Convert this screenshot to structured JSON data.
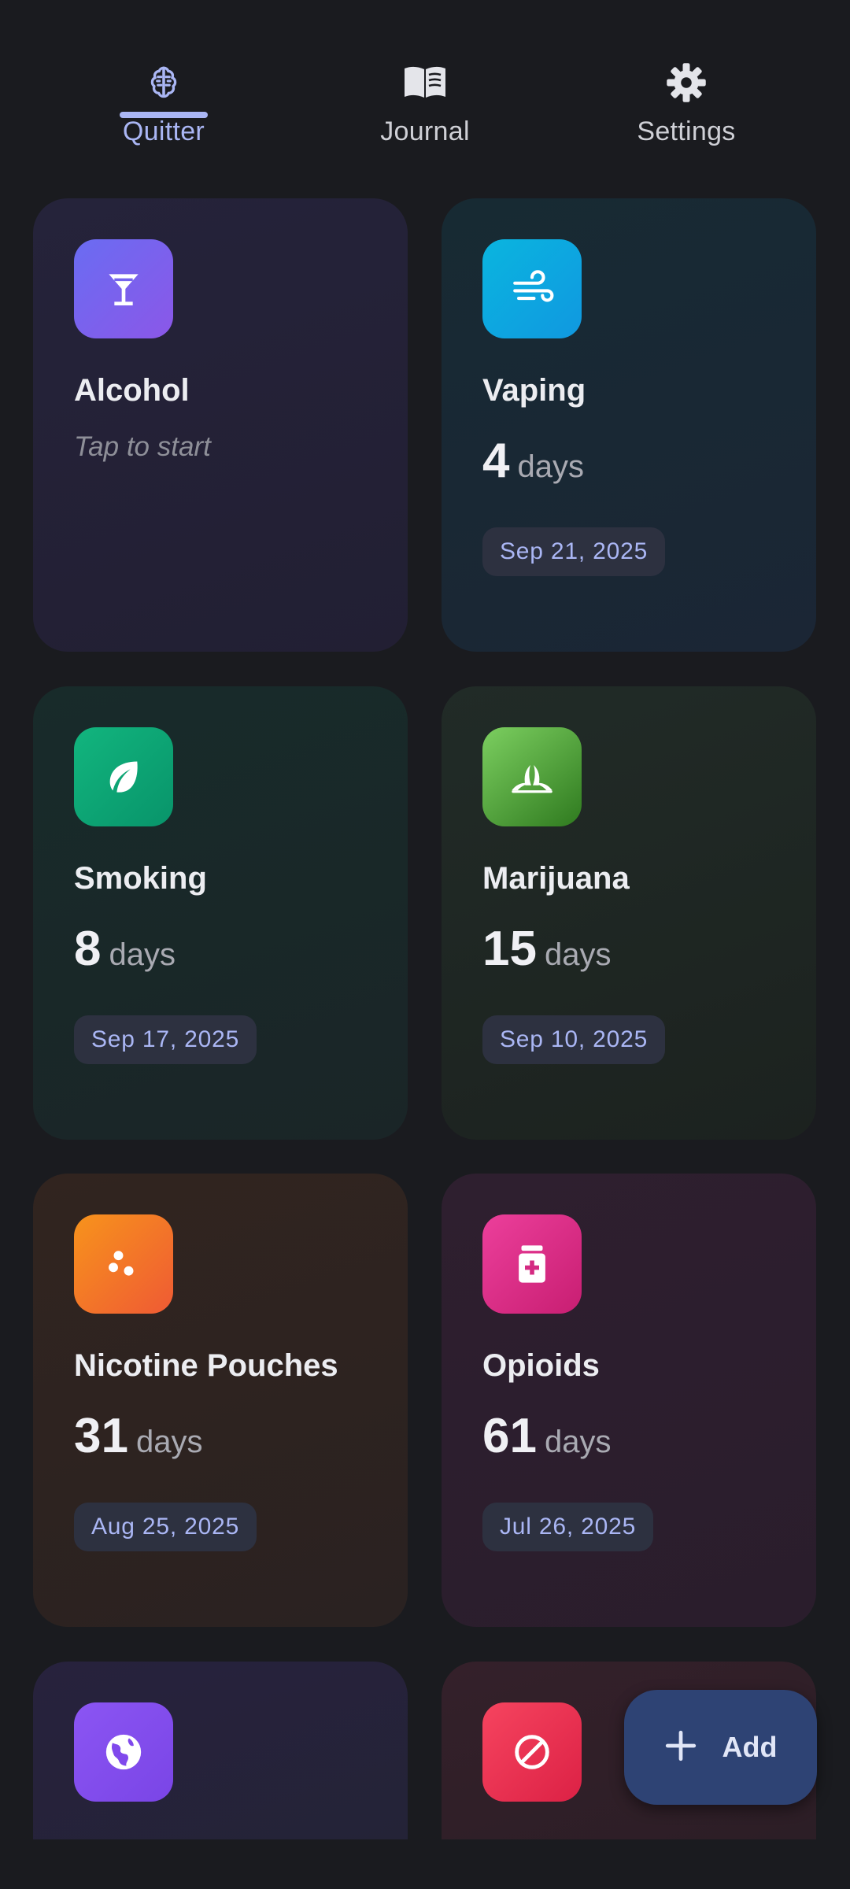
{
  "tabs": [
    {
      "label": "Quitter",
      "icon": "brain-icon",
      "active": true
    },
    {
      "label": "Journal",
      "icon": "book-icon",
      "active": false
    },
    {
      "label": "Settings",
      "icon": "gear-icon",
      "active": false
    }
  ],
  "cards": [
    {
      "title": "Alcohol",
      "hint": "Tap to start",
      "icon": "cocktail-glass-icon"
    },
    {
      "title": "Vaping",
      "count": "4",
      "unit": "days",
      "date": "Sep 21, 2025",
      "icon": "wind-icon"
    },
    {
      "title": "Smoking",
      "count": "8",
      "unit": "days",
      "date": "Sep 17, 2025",
      "icon": "leaf-icon"
    },
    {
      "title": "Marijuana",
      "count": "15",
      "unit": "days",
      "date": "Sep 10, 2025",
      "icon": "grass-icon"
    },
    {
      "title": "Nicotine Pouches",
      "count": "31",
      "unit": "days",
      "date": "Aug 25, 2025",
      "icon": "pouches-icon"
    },
    {
      "title": "Opioids",
      "count": "61",
      "unit": "days",
      "date": "Jul 26, 2025",
      "icon": "pill-bottle-icon"
    },
    {
      "icon": "globe-icon"
    },
    {
      "icon": "block-icon"
    }
  ],
  "fab": {
    "label": "Add",
    "icon": "plus-icon"
  },
  "colors": {
    "background": "#1a1b1f",
    "accent": "#aab6f4",
    "date_chip": "#2d3140",
    "fab": "#2e4374"
  }
}
